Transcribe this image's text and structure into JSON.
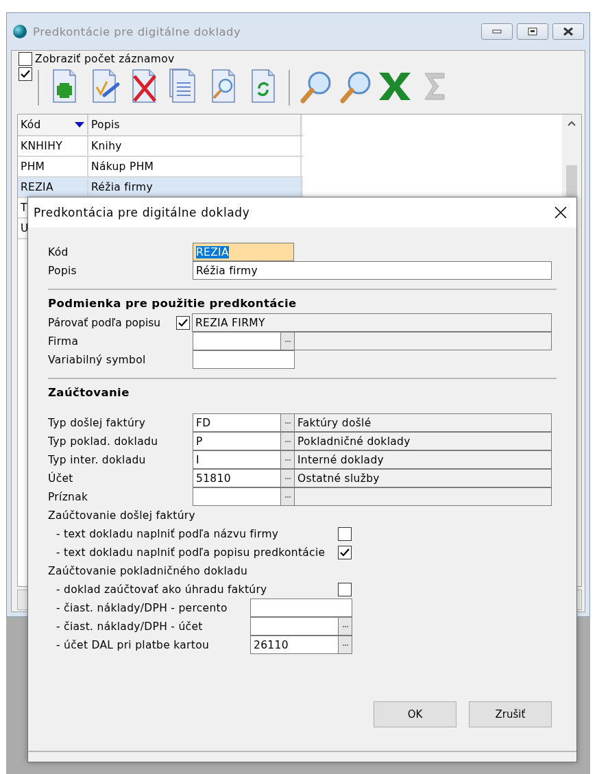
{
  "main_window": {
    "title": "Predkontácie pre digitálne doklady",
    "show_count": {
      "label": "Zobraziť počet záznamov",
      "checked": false
    },
    "toolbar_checkbox": {
      "checked": true
    },
    "table": {
      "columns": [
        {
          "label": "Kód",
          "sorted": true
        },
        {
          "label": "Popis",
          "sorted": false
        }
      ],
      "rows": [
        {
          "cells": [
            "KNHIHY",
            "Knihy"
          ],
          "selected": false
        },
        {
          "cells": [
            "PHM",
            "Nákup PHM"
          ],
          "selected": false
        },
        {
          "cells": [
            "REZIA",
            "Réžia firmy"
          ],
          "selected": true
        },
        {
          "cells": [
            "T"
          ],
          "selected": false
        },
        {
          "cells": [
            "U"
          ],
          "selected": false
        }
      ]
    }
  },
  "dialog": {
    "title": "Predkontácia pre digitálne doklady",
    "fields": [
      {
        "kind": "short",
        "label": "Kód",
        "value": "REZIA",
        "focused": true
      },
      {
        "kind": "wide",
        "label": "Popis",
        "value": "Réžia firmy",
        "focused": false
      }
    ],
    "condition": {
      "heading": "Podmienka pre použitie predkontácie",
      "match": {
        "label": "Párovať podľa popisu",
        "checked": true,
        "value": "REZIA FIRMY"
      },
      "company": {
        "label": "Firma"
      },
      "variable_symbol": {
        "label": "Variabilný symbol"
      }
    },
    "posting": {
      "heading": "Zaúčtovanie",
      "lookups": [
        {
          "label": "Typ došlej faktúry",
          "code": "FD",
          "description": "Faktúry došlé"
        },
        {
          "label": "Typ poklad. dokladu",
          "code": "P",
          "description": "Pokladničné doklady"
        },
        {
          "label": "Typ inter. dokladu",
          "code": "I",
          "description": "Interné doklady"
        },
        {
          "label": "Účet",
          "code": "51810",
          "description": "Ostatné služby"
        },
        {
          "label": "Príznak"
        }
      ],
      "groups": [
        {
          "title": "Zaúčtovanie došlej faktúry",
          "items": [
            {
              "kind": "checkbox",
              "label": "- text dokladu naplniť podľa názvu firmy",
              "checked": false
            },
            {
              "kind": "checkbox",
              "label": "- text dokladu naplniť podľa popisu predkontácie",
              "checked": true
            }
          ]
        },
        {
          "title": "Zaúčtovanie pokladničného dokladu",
          "items": [
            {
              "kind": "checkbox",
              "label": "- doklad zaúčtovať ako úhradu faktúry",
              "checked": false
            },
            {
              "kind": "input",
              "label": "- čiast. náklady/DPH - percento"
            },
            {
              "kind": "lookup",
              "label": "- čiast. náklady/DPH - účet"
            },
            {
              "kind": "lookup",
              "label": "- účet DAL pri platbe kartou",
              "value": "26110"
            }
          ]
        }
      ]
    },
    "buttons": [
      "OK",
      "Zrušiť"
    ]
  }
}
